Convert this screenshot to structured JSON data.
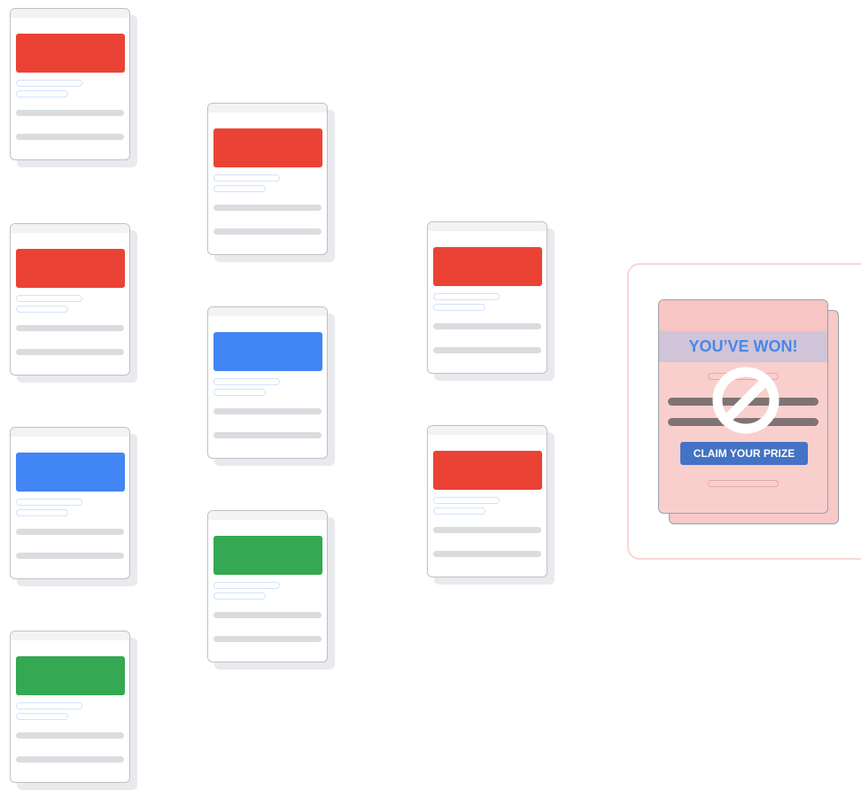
{
  "colors": {
    "red": "#ea4335",
    "blue": "#4285f4",
    "green": "#34a853",
    "spam_background": "#f9cfcd",
    "spam_frame": "#f8d7d5",
    "claim_button": "#4472c4",
    "headline_text": "#4a86e8"
  },
  "cards": [
    {
      "banner_color": "red"
    },
    {
      "banner_color": "red"
    },
    {
      "banner_color": "blue"
    },
    {
      "banner_color": "green"
    },
    {
      "banner_color": "red"
    },
    {
      "banner_color": "blue"
    },
    {
      "banner_color": "green"
    },
    {
      "banner_color": "red"
    },
    {
      "banner_color": "red"
    }
  ],
  "spam_page": {
    "headline": "YOU’VE WON!",
    "button_label": "CLAIM YOUR PRIZE",
    "icon": "block-icon"
  }
}
